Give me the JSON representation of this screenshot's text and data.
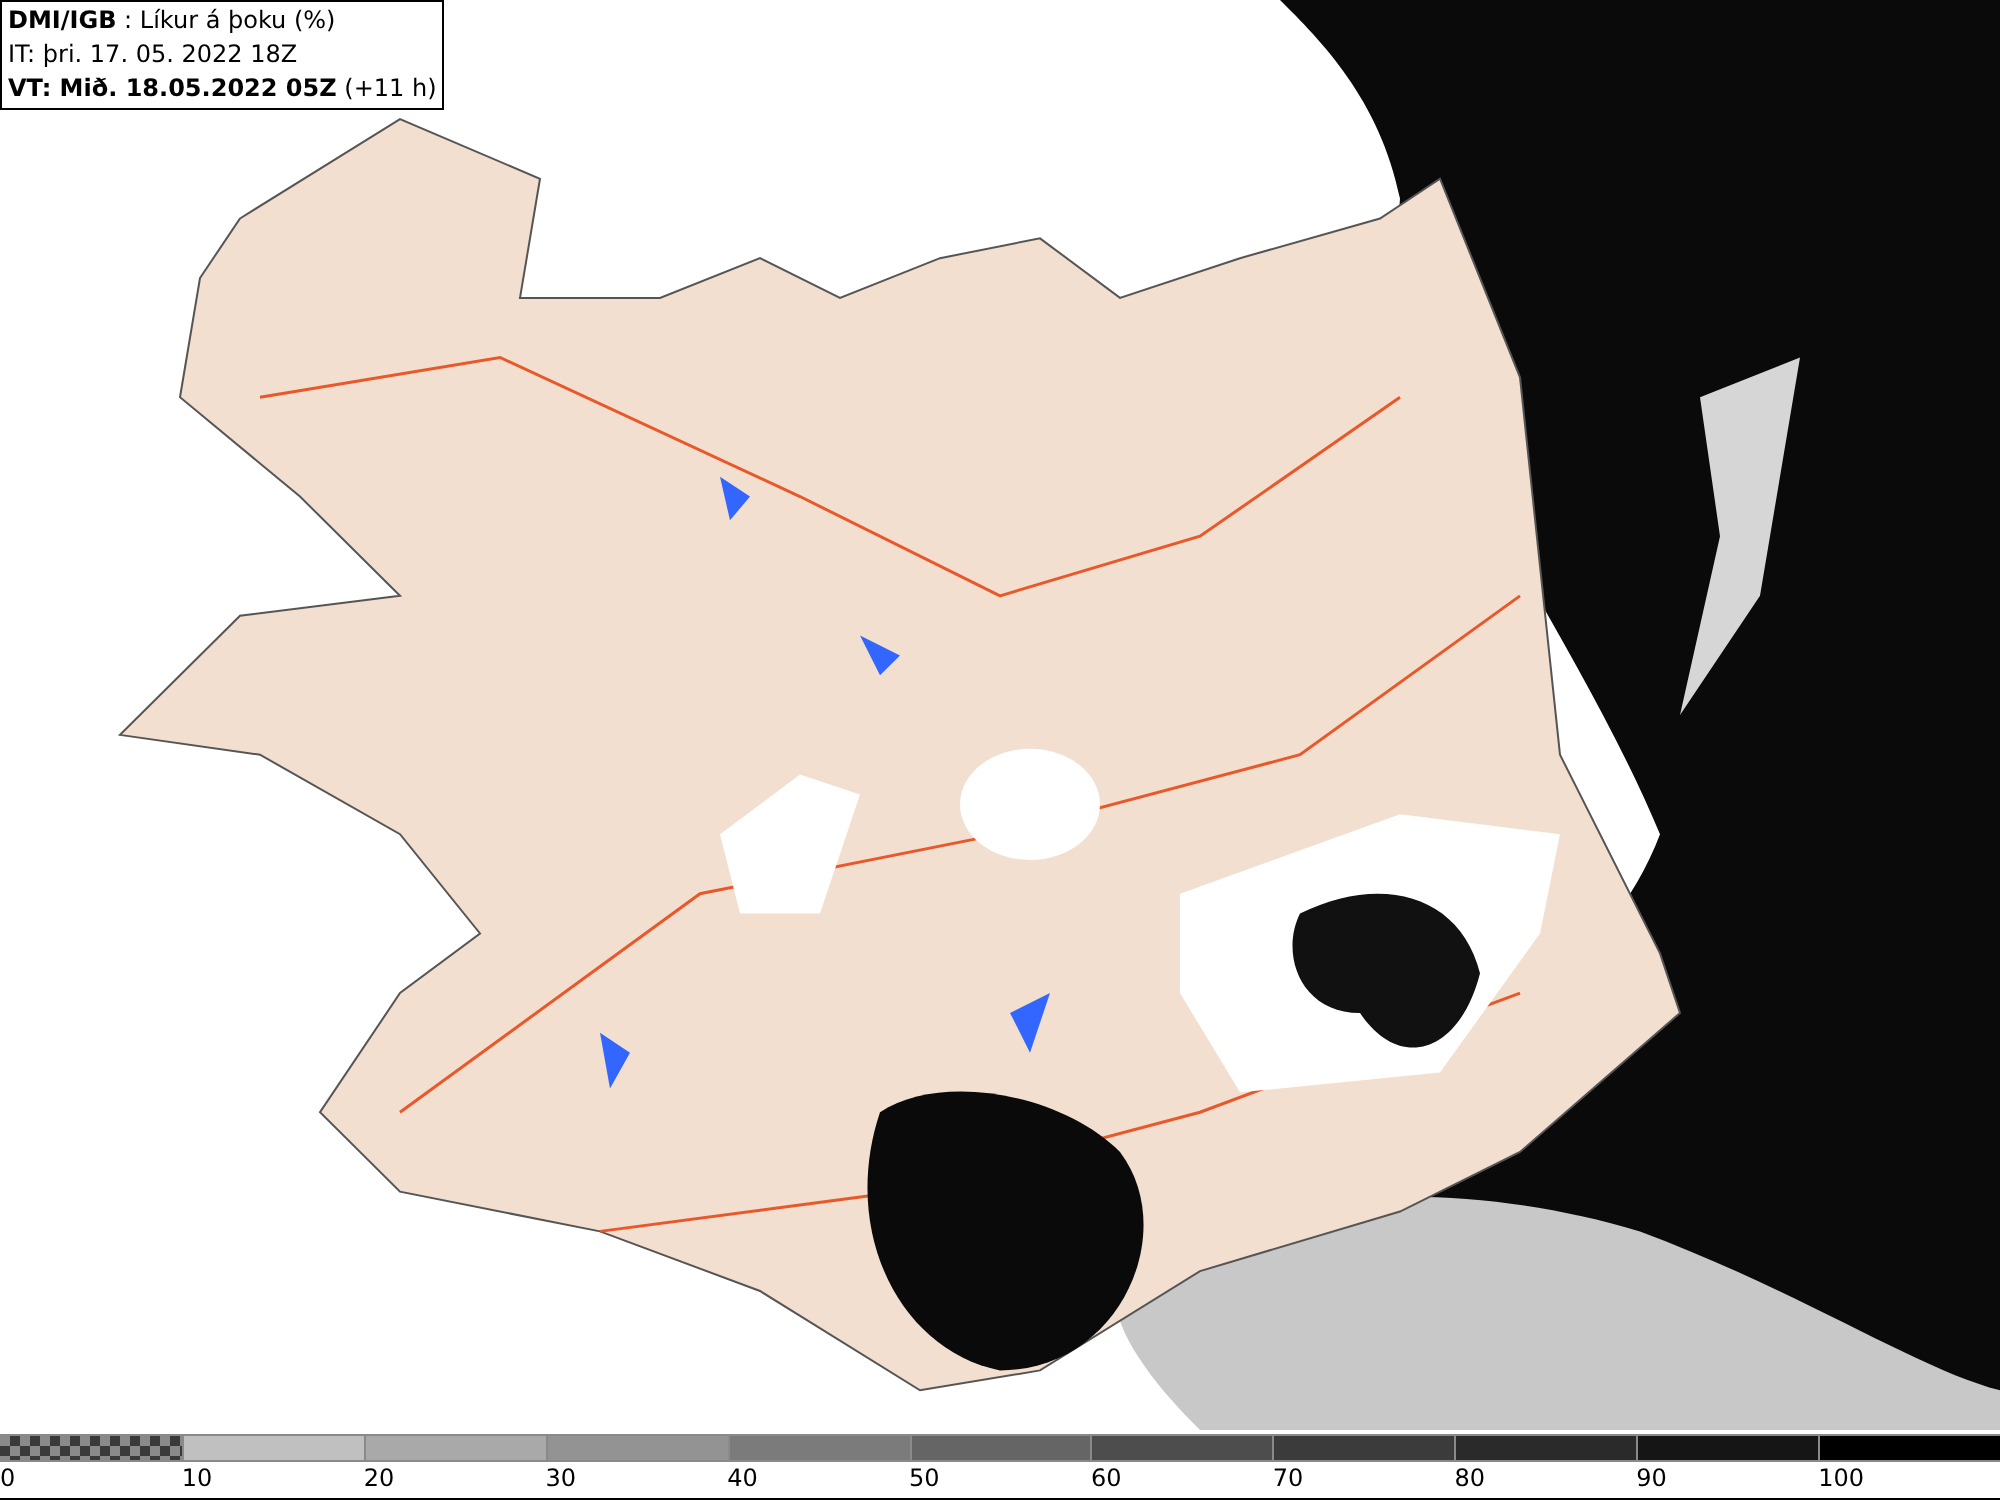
{
  "info_box": {
    "lines": [
      "**DMI/IGB** : Líkur á þoku (%)",
      "IT: þri. 17. 05. 2022 18Z",
      "**VT: Mið. 18.05.2022 05Z** (+11 h)"
    ]
  },
  "legend": {
    "segments": [
      {
        "kind": "checker"
      },
      {
        "kind": "solid",
        "color": "#c0c0c0"
      },
      {
        "kind": "solid",
        "color": "#a9a9a9"
      },
      {
        "kind": "solid",
        "color": "#939393"
      },
      {
        "kind": "solid",
        "color": "#7b7b7b"
      },
      {
        "kind": "solid",
        "color": "#656565"
      },
      {
        "kind": "solid",
        "color": "#4d4d4d"
      },
      {
        "kind": "solid",
        "color": "#3b3b3b"
      },
      {
        "kind": "solid",
        "color": "#2a2a2a"
      },
      {
        "kind": "solid",
        "color": "#151515"
      },
      {
        "kind": "solid",
        "color": "#000000"
      }
    ],
    "labels": [
      "0",
      "10",
      "20",
      "30",
      "40",
      "50",
      "60",
      "70",
      "80",
      "90",
      "100"
    ]
  }
}
